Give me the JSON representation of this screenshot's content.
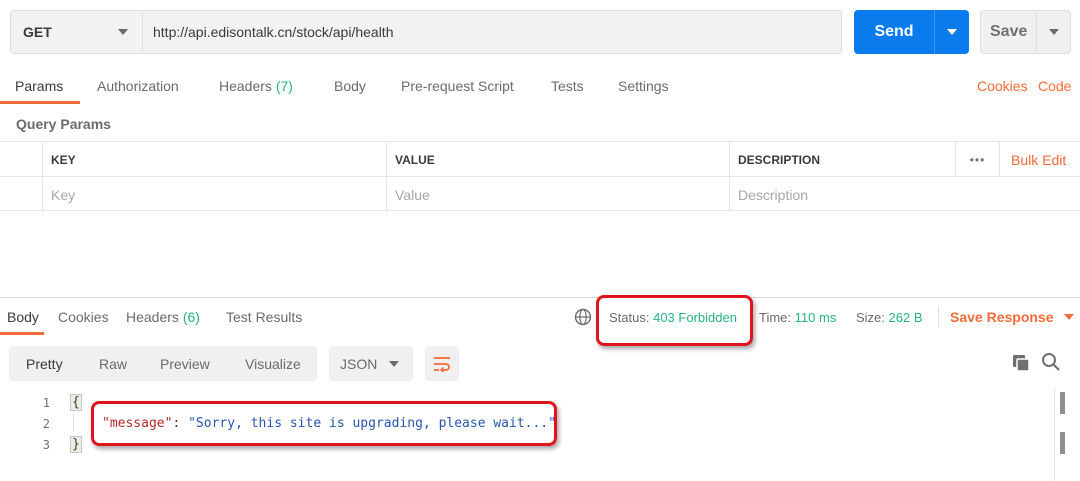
{
  "request": {
    "method": "GET",
    "url": "http://api.edisontalk.cn/stock/api/health",
    "send_label": "Send",
    "save_label": "Save"
  },
  "request_tabs": [
    {
      "label": "Params",
      "count": "",
      "active": true
    },
    {
      "label": "Authorization",
      "count": ""
    },
    {
      "label": "Headers",
      "count": "(7)"
    },
    {
      "label": "Body",
      "count": ""
    },
    {
      "label": "Pre-request Script",
      "count": ""
    },
    {
      "label": "Tests",
      "count": ""
    },
    {
      "label": "Settings",
      "count": ""
    }
  ],
  "request_links": {
    "cookies": "Cookies",
    "code": "Code"
  },
  "query_params": {
    "title": "Query Params",
    "columns": {
      "key": "KEY",
      "value": "VALUE",
      "description": "DESCRIPTION"
    },
    "more": "•••",
    "bulk_edit": "Bulk Edit",
    "placeholders": {
      "key": "Key",
      "value": "Value",
      "description": "Description"
    }
  },
  "response_tabs": [
    {
      "label": "Body",
      "count": "",
      "active": true
    },
    {
      "label": "Cookies",
      "count": ""
    },
    {
      "label": "Headers",
      "count": "(6)"
    },
    {
      "label": "Test Results",
      "count": ""
    }
  ],
  "response_meta": {
    "status_label": "Status:",
    "status_value": "403 Forbidden",
    "time_label": "Time:",
    "time_value": "110 ms",
    "size_label": "Size:",
    "size_value": "262 B",
    "save_response": "Save Response"
  },
  "view_modes": [
    "Pretty",
    "Raw",
    "Preview",
    "Visualize"
  ],
  "active_view": "Pretty",
  "format": "JSON",
  "code": {
    "line_numbers": [
      "1",
      "2",
      "3"
    ],
    "open_brace": "{",
    "close_brace": "}",
    "key": "\"message\"",
    "colon": ": ",
    "value": "\"Sorry, this site is upgrading, please wait...\""
  },
  "colors": {
    "accent_orange": "#f26b3a",
    "send_blue": "#097bed",
    "status_green": "#26b47f",
    "highlight_red": "#e0141d"
  }
}
